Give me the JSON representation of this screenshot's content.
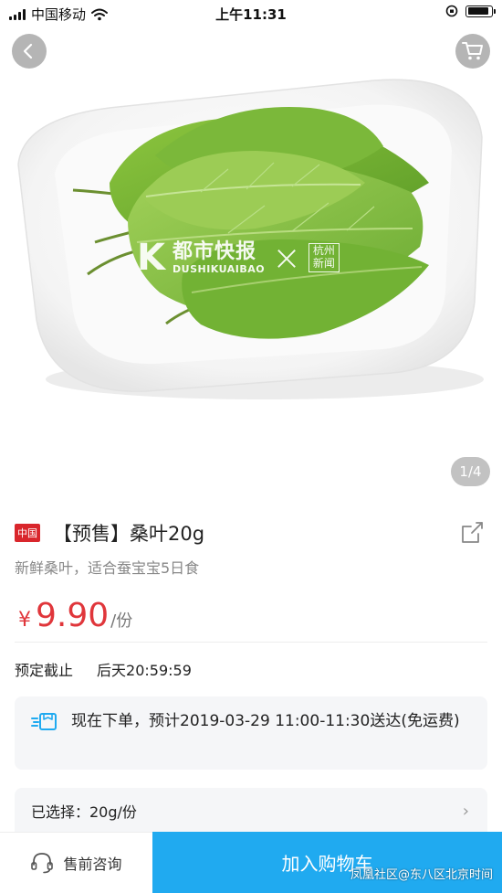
{
  "status_bar": {
    "carrier": "中国移动",
    "time": "上午11:31",
    "battery_level": 0.9
  },
  "hero": {
    "watermark": {
      "letter": "K",
      "name": "都市快报",
      "name_en": "DUSHIKUAIBAO",
      "separator": "×",
      "partner": "杭州新闻"
    },
    "pager": "1/4"
  },
  "product": {
    "origin_badge": "中国",
    "title": "【预售】桑叶20g",
    "subtitle": "新鲜桑叶，适合蚕宝宝5日食",
    "price_symbol": "¥",
    "price": "9.90",
    "price_unit": "/份",
    "deadline_label": "预定截止",
    "deadline_value": "后天20:59:59"
  },
  "delivery": {
    "text": "现在下单，预计2019-03-29 11:00-11:30送达(免运费)"
  },
  "selection": {
    "label": "已选择：20g/份",
    "chevron": "›"
  },
  "bottom_bar": {
    "consult_label": "售前咨询",
    "add_to_cart_label": "加入购物车",
    "credit": "凤凰社区@东八区北京时间"
  },
  "colors": {
    "accent": "#20aaf0",
    "price": "#e0363b",
    "badge": "#d9262c"
  },
  "icons": [
    "signal-icon",
    "wifi-icon",
    "orientation-lock-icon",
    "battery-icon",
    "back-arrow-icon",
    "cart-icon",
    "share-icon",
    "delivery-box-icon",
    "headset-icon"
  ]
}
